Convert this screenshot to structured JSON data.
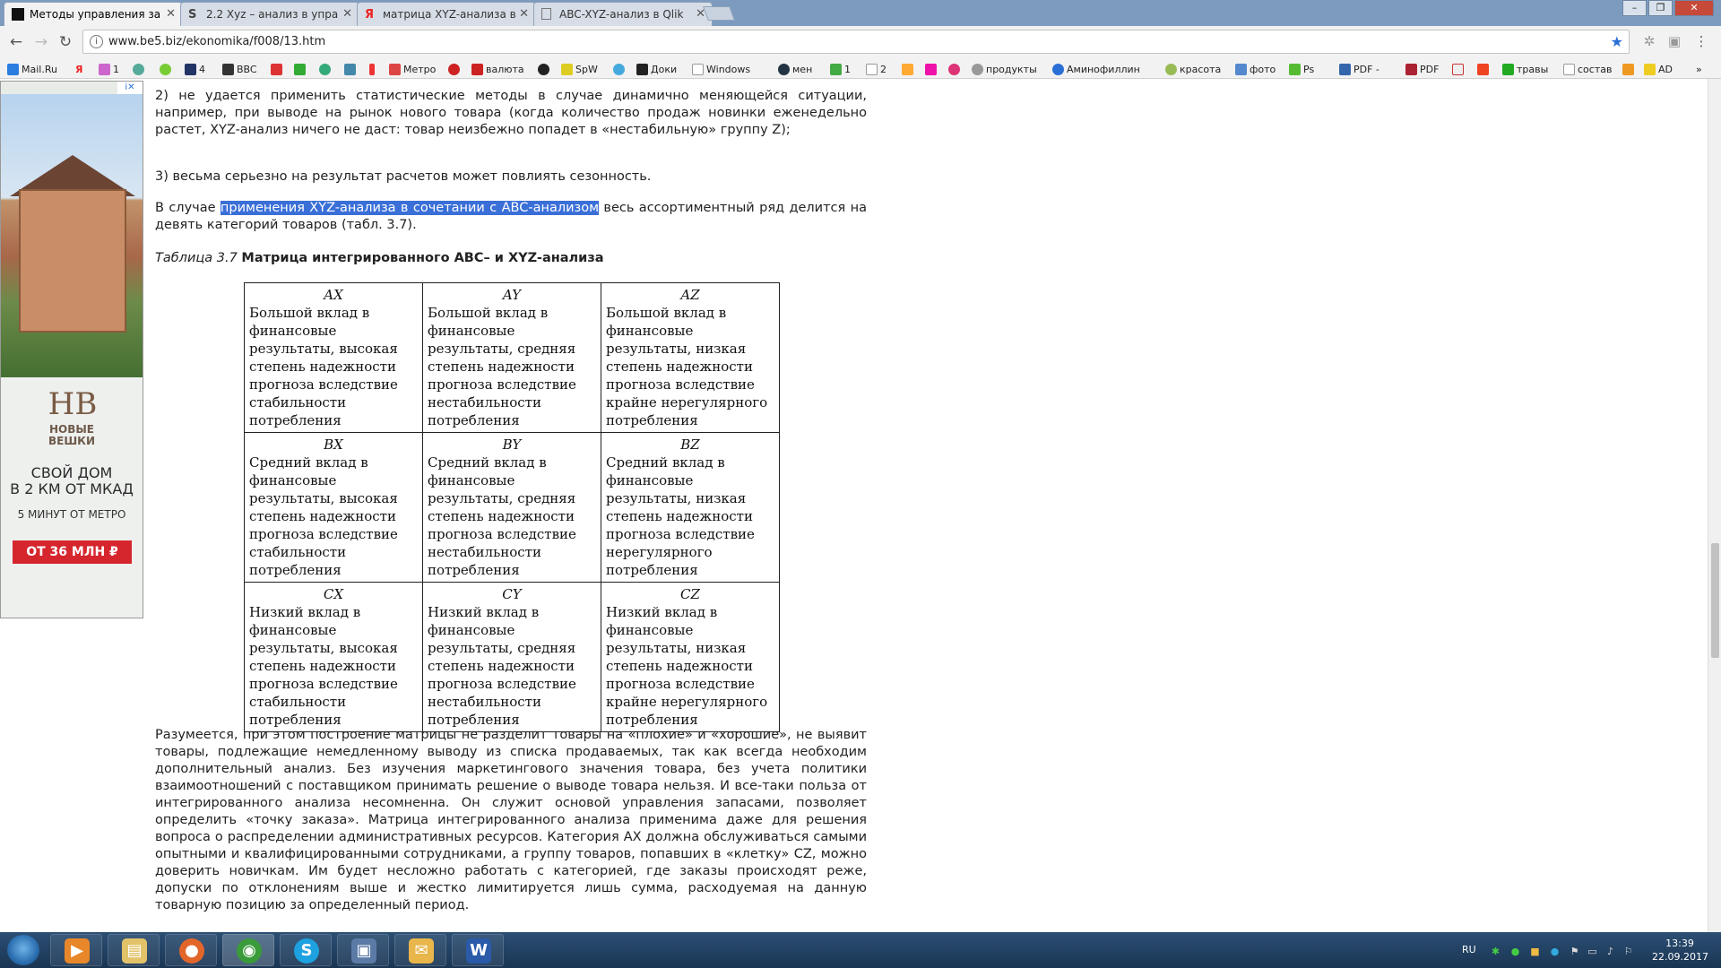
{
  "tabs": [
    {
      "label": "Методы управления за",
      "favicon": "be5-icon",
      "active": true
    },
    {
      "label": "2.2 Xyz – анализ в упра",
      "favicon": "s-icon",
      "active": false
    },
    {
      "label": "матрица XYZ-анализа в",
      "favicon": "yandex-icon",
      "active": false
    },
    {
      "label": "ABC-XYZ-анализ в Qlik",
      "favicon": "page-icon",
      "active": false
    }
  ],
  "address": {
    "url": "www.be5.biz/ekonomika/f008/13.htm"
  },
  "bookmarks": [
    "Mail.Ru",
    "",
    "1",
    "",
    "",
    "",
    "4",
    "BBC",
    "",
    "",
    "",
    "",
    "Метро",
    "",
    "валюта",
    "",
    "SpW",
    "",
    "Доки",
    "Windows",
    "мен",
    "1",
    "2",
    "",
    "",
    "",
    "продукты",
    "Аминофиллин",
    "красота",
    "фото",
    "Ps",
    "PDF -",
    "PDF",
    "",
    "",
    "травы",
    "состав",
    "AD"
  ],
  "ad": {
    "badge": "i✕",
    "logo": "НВ",
    "brand_line1": "НОВЫЕ",
    "brand_line2": "ВЕШКИ",
    "headline_line1": "СВОЙ ДОМ",
    "headline_line2": "В 2 КМ ОТ МКАД",
    "sub": "5 МИНУТ ОТ МЕТРО",
    "price": "ОТ 36 МЛН ₽"
  },
  "article": {
    "p1": "2) не удается применить статистические методы в случае динамично меняющейся ситуации, например, при выводе на рынок нового товара (когда количество продаж новинки еженедельно растет, XYZ-анализ ничего не даст: товар неизбежно попадет в «нестабильную» группу Z);",
    "p2": "3) весьма серьезно на результат расчетов может повлиять сезонность.",
    "p3_before": "В случае ",
    "p3_selected": "применения XYZ-анализа в сочетании с ABC-анализом",
    "p3_after": " весь ассортиментный ряд делится на девять категорий товаров (табл. 3.7).",
    "caption_prefix": "Таблица 3.7",
    "caption_title": "Матрица интегрированного ABC– и XYZ-анализа",
    "p4": "Разумеется, при этом построение матрицы не разделит товары на «плохие» и «хорошие», не выявит товары, подлежащие немедленному выводу из списка продаваемых, так как всегда необходим дополнительный анализ. Без изучения маркетингового значения товара, без учета политики взаимоотношений с поставщиком принимать решение о выводе товара нельзя. И все-таки польза от интегрированного анализа несомненна. Он служит основой управления запасами, позволяет определить «точку заказа». Матрица интегрированного анализа применима даже для решения вопроса о распределении административных ресурсов. Категория AX должна обслуживаться самыми опытными и квалифицированными сотрудниками, а группу товаров, попавших в «клетку» CZ, можно доверить новичкам. Им будет несложно работать с категорией, где заказы происходят реже, допуски по отклонениям выше и жестко лимитируется лишь сумма, расходуемая на данную товарную позицию за определенный период."
  },
  "matrix": {
    "rows": [
      [
        {
          "code": "AX",
          "text": "Большой вклад в финансовые результаты, высокая степень надежности прогноза вследствие стабильности потребления"
        },
        {
          "code": "AY",
          "text": "Большой вклад в финансовые результаты, средняя степень надежности прогноза вследствие нестабильности потребления"
        },
        {
          "code": "AZ",
          "text": "Большой вклад в финансовые результаты, низкая степень надежности прогноза вследствие крайне нерегулярного потребления"
        }
      ],
      [
        {
          "code": "BX",
          "text": "Средний вклад в финансовые результаты, высокая степень надежности прогноза вследствие стабильности потребления"
        },
        {
          "code": "BY",
          "text": "Средний вклад в финансовые результаты, средняя степень надежности прогноза вследствие нестабильности потребления"
        },
        {
          "code": "BZ",
          "text": "Средний вклад в финансовые результаты, низкая степень надежности прогноза вследствие нерегулярного потребления"
        }
      ],
      [
        {
          "code": "CX",
          "text": "Низкий вклад в финансовые результаты, высокая степень надежности прогноза вследствие стабильности потребления"
        },
        {
          "code": "CY",
          "text": "Низкий вклад в финансовые результаты, средняя степень надежности прогноза вследствие нестабильности потребления"
        },
        {
          "code": "CZ",
          "text": "Низкий вклад в финансовые результаты, низкая степень надежности прогноза вследствие крайне нерегулярного потребления"
        }
      ]
    ]
  },
  "taskbar": {
    "language": "RU",
    "time": "13:39",
    "date": "22.09.2017"
  }
}
